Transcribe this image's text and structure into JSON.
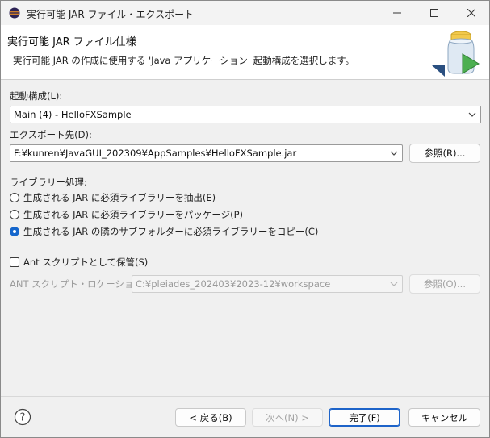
{
  "window": {
    "title": "実行可能 JAR ファイル・エクスポート"
  },
  "banner": {
    "title": "実行可能 JAR ファイル仕様",
    "description": "実行可能 JAR の作成に使用する 'Java アプリケーション' 起動構成を選択します。"
  },
  "launch_config": {
    "label": "起動構成(L):",
    "selected": "Main (4) - HelloFXSample"
  },
  "export_destination": {
    "label": "エクスポート先(D):",
    "value": "F:¥kunren¥JavaGUI_202309¥AppSamples¥HelloFXSample.jar",
    "browse_label": "参照(R)..."
  },
  "library_handling": {
    "label": "ライブラリー処理:",
    "options": [
      {
        "label": "生成される JAR に必須ライブラリーを抽出(E)",
        "checked": false
      },
      {
        "label": "生成される JAR に必須ライブラリーをパッケージ(P)",
        "checked": false
      },
      {
        "label": "生成される JAR の隣のサブフォルダーに必須ライブラリーをコピー(C)",
        "checked": true
      }
    ]
  },
  "ant": {
    "save_checkbox_label": "Ant スクリプトとして保管(S)",
    "save_checked": false,
    "location_label": "ANT スクリプト・ロケーション(A):",
    "location_value": "C:¥pleiades_202403¥2023-12¥workspace",
    "browse_label": "参照(O)..."
  },
  "footer": {
    "back_label": "< 戻る(B)",
    "next_label": "次へ(N) >",
    "finish_label": "完了(F)",
    "cancel_label": "キャンセル"
  },
  "icons": {
    "app": "eclipse-icon",
    "minimize": "minimize-icon",
    "maximize": "maximize-icon",
    "close": "close-icon",
    "banner": "jar-export-wizard-icon",
    "help": "help-icon"
  },
  "colors": {
    "accent": "#1566cc",
    "primary_button_border": "#1d63c9",
    "disabled_text": "#9a9a9a"
  }
}
